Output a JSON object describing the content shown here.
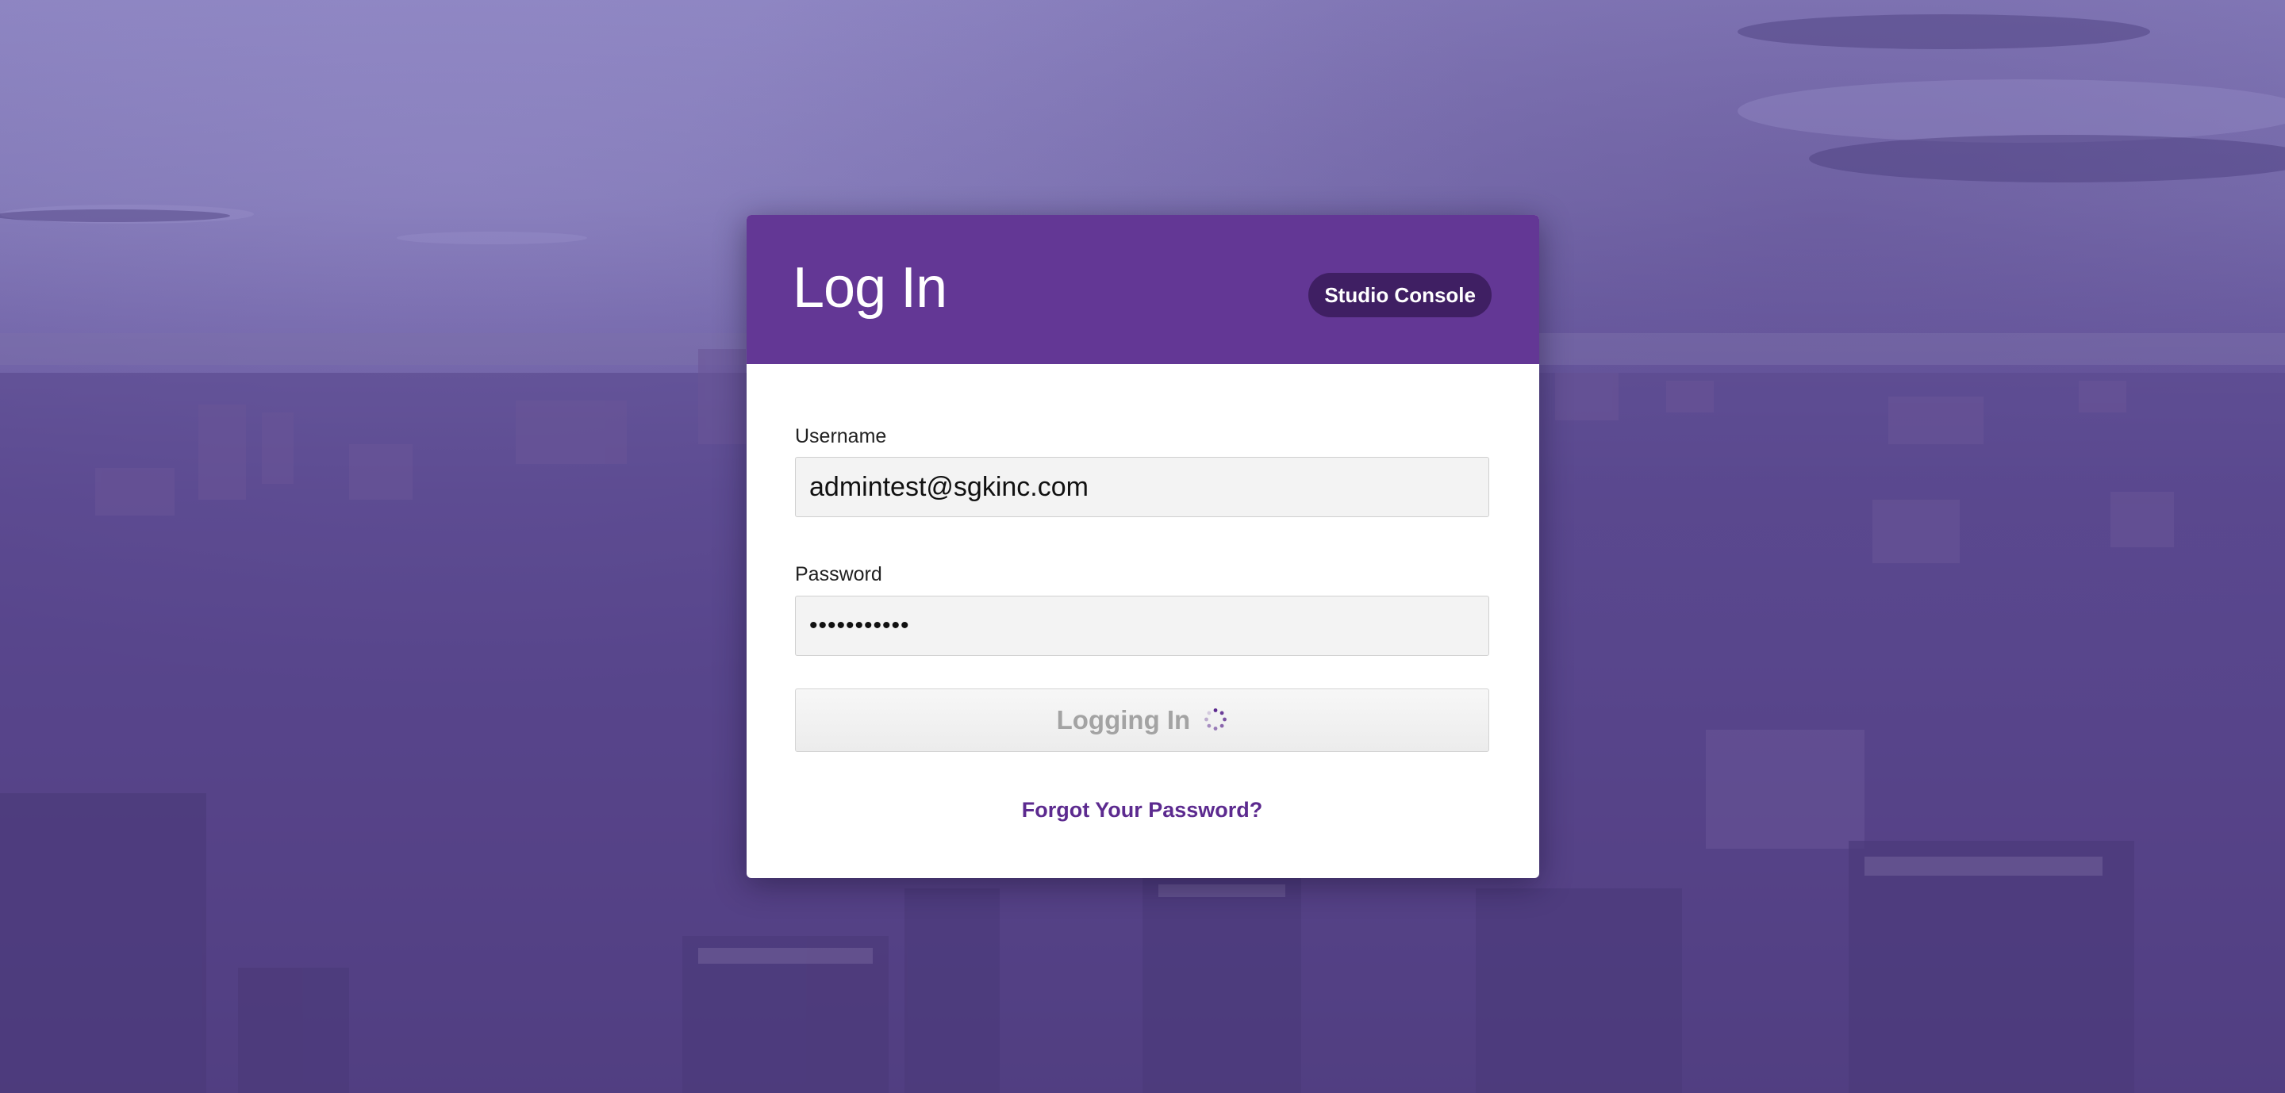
{
  "login": {
    "title": "Log In",
    "badge": "Studio Console",
    "username_label": "Username",
    "username_value": "admintest@sgkinc.com",
    "password_label": "Password",
    "password_value": "•••••••••••",
    "submit_label": "Logging In",
    "forgot_link": "Forgot Your Password?"
  },
  "colors": {
    "header": "#633795",
    "badge": "#3f1f63",
    "link": "#5c2a8f",
    "overlay": "#5a4690"
  },
  "icons": {
    "spinner": "loading-spinner-icon"
  }
}
